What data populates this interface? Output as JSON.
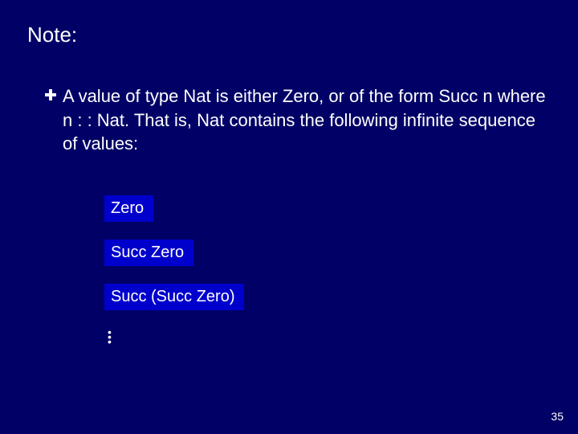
{
  "title": "Note:",
  "bullet": {
    "text": "A value of type Nat is either Zero, or of the form Succ n where n : : Nat.  That is, Nat contains the following infinite sequence of values:"
  },
  "examples": [
    "Zero",
    "Succ Zero",
    "Succ (Succ Zero)"
  ],
  "page_number": "35"
}
